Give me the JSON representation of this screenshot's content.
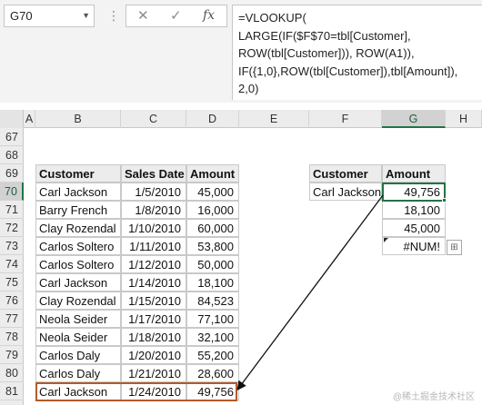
{
  "name_box": {
    "value": "G70"
  },
  "formula_bar": {
    "cancel_glyph": "✕",
    "enter_glyph": "✓",
    "fx_glyph": "fx",
    "lines": [
      "=VLOOKUP(",
      "LARGE(IF($F$70=tbl[Customer],",
      "ROW(tbl[Customer])), ROW(A1)),",
      "IF({1,0},ROW(tbl[Customer]),tbl[Amount]),",
      "2,0)"
    ]
  },
  "columns": [
    "A",
    "B",
    "C",
    "D",
    "E",
    "F",
    "G",
    "H"
  ],
  "selected_column": "G",
  "rows": [
    "67",
    "68",
    "69",
    "70",
    "71",
    "72",
    "73",
    "74",
    "75",
    "76",
    "77",
    "78",
    "79",
    "80",
    "81"
  ],
  "selected_row": "70",
  "table": {
    "headers": [
      "Customer",
      "Sales Date",
      "Amount"
    ],
    "rows": [
      [
        "Carl Jackson",
        "1/5/2010",
        "45,000"
      ],
      [
        "Barry French",
        "1/8/2010",
        "16,000"
      ],
      [
        "Clay Rozendal",
        "1/10/2010",
        "60,000"
      ],
      [
        "Carlos Soltero",
        "1/11/2010",
        "53,800"
      ],
      [
        "Carlos Soltero",
        "1/12/2010",
        "50,000"
      ],
      [
        "Carl Jackson",
        "1/14/2010",
        "18,100"
      ],
      [
        "Clay Rozendal",
        "1/15/2010",
        "84,523"
      ],
      [
        "Neola Seider",
        "1/17/2010",
        "77,100"
      ],
      [
        "Neola Seider",
        "1/18/2010",
        "32,100"
      ],
      [
        "Carlos Daly",
        "1/20/2010",
        "55,200"
      ],
      [
        "Carlos Daly",
        "1/21/2010",
        "28,600"
      ],
      [
        "Carl Jackson",
        "1/24/2010",
        "49,756"
      ]
    ]
  },
  "lookup": {
    "headers": [
      "Customer",
      "Amount"
    ],
    "customer": "Carl Jackson",
    "results": [
      "49,756",
      "18,100",
      "45,000",
      "#NUM!"
    ]
  },
  "watermark": "@稀土掘金技术社区",
  "colors": {
    "selection": "#217346",
    "highlight": "#b35a2a"
  }
}
